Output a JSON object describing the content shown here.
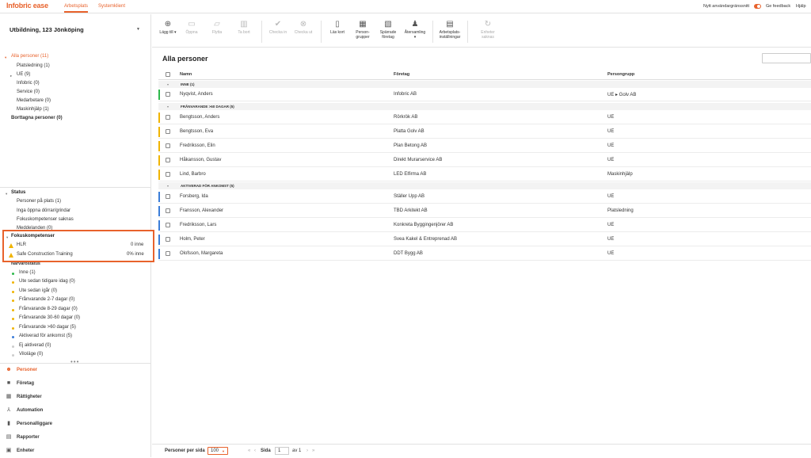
{
  "app": {
    "logo": "Infobric ease",
    "tabs": [
      "Arbetsplats",
      "Systemklient"
    ],
    "top_right": {
      "new_ui": "Nytt användargränssnitt",
      "feedback": "Ge feedback",
      "help": "Hjälp"
    },
    "accent_color": "#e8622c"
  },
  "sidebar": {
    "site_name": "Utbildning, 123 Jönköping",
    "groups": [
      {
        "label": "Alla personer (11)"
      },
      {
        "label": "Platsledning (1)"
      },
      {
        "label": "UE (9)"
      },
      {
        "label": "Infobric (0)"
      },
      {
        "label": "Service (0)"
      },
      {
        "label": "Medarbetare (0)"
      },
      {
        "label": "Maskinhjälp (1)"
      },
      {
        "label": "Borttagna personer (0)"
      }
    ],
    "status": {
      "heading": "Status",
      "items": [
        "Personer på plats (1)",
        "Inga öppna dörrar/grindar",
        "Fokuskompetenser saknas",
        "Meddelanden (0)"
      ]
    },
    "focus": {
      "heading": "Fokuskompetenser",
      "items": [
        {
          "label": "HLR",
          "value": "0 inne"
        },
        {
          "label": "Safe Construction Training",
          "value": "0% inne"
        }
      ]
    },
    "presence": {
      "heading": "Närvarostatus",
      "items": [
        {
          "label": "Inne (1)",
          "color": "#2eb84b"
        },
        {
          "label": "Ute sedan tidigare idag (0)",
          "color": "#f0b400"
        },
        {
          "label": "Ute sedan igår (0)",
          "color": "#f0b400"
        },
        {
          "label": "Frånvarande 2-7 dagar (0)",
          "color": "#f0b400"
        },
        {
          "label": "Frånvarande 8-29 dagar (0)",
          "color": "#f0b400"
        },
        {
          "label": "Frånvarande 30-60 dagar (0)",
          "color": "#f0b400"
        },
        {
          "label": "Frånvarande >60 dagar (5)",
          "color": "#f0b400"
        },
        {
          "label": "Aktiverad för ankomst (5)",
          "color": "#3b7dd8"
        },
        {
          "label": "Ej aktiverad (0)",
          "color": "#cccccc"
        },
        {
          "label": "Viloläge (0)",
          "color": "#cccccc"
        }
      ]
    },
    "nav": [
      {
        "label": "Personer",
        "icon": "people-icon"
      },
      {
        "label": "Företag",
        "icon": "briefcase-icon"
      },
      {
        "label": "Rättigheter",
        "icon": "calendar-icon"
      },
      {
        "label": "Automation",
        "icon": "network-icon"
      },
      {
        "label": "Personalliggare",
        "icon": "book-icon"
      },
      {
        "label": "Rapporter",
        "icon": "report-icon"
      },
      {
        "label": "Enheter",
        "icon": "device-icon"
      }
    ]
  },
  "toolbar": {
    "items": [
      {
        "label": "Lägg till",
        "icon": "plus-circle-icon",
        "disabled": false
      },
      {
        "label": "Öppna",
        "icon": "folder-open-icon",
        "disabled": true
      },
      {
        "label": "Flytta",
        "icon": "move-icon",
        "disabled": true
      },
      {
        "label": "Ta bort",
        "icon": "trash-icon",
        "disabled": true
      },
      {
        "label": "Checka in",
        "icon": "check-circle-icon",
        "disabled": true
      },
      {
        "label": "Checka ut",
        "icon": "x-circle-icon",
        "disabled": true
      },
      {
        "label": "Läs kort",
        "icon": "card-reader-icon",
        "disabled": false
      },
      {
        "label": "Person-\ngrupper",
        "icon": "group-icon",
        "disabled": false
      },
      {
        "label": "Spärrade\nföretag",
        "icon": "blocked-company-icon",
        "disabled": false
      },
      {
        "label": "Återsamling",
        "icon": "bell-icon",
        "disabled": false
      },
      {
        "label": "Arbetsplats-\ninställningar",
        "icon": "settings-icon",
        "disabled": false
      },
      {
        "label": "Enheter\nsaknas",
        "icon": "sync-icon",
        "disabled": true
      }
    ]
  },
  "main": {
    "title": "Alla personer",
    "columns": [
      "Namn",
      "Företag",
      "Persongrupp"
    ],
    "groups": [
      {
        "label": "INNE (1)",
        "color": "#2eb84b",
        "rows": [
          {
            "name": "Nyqvist, Anders",
            "company": "Infobric AB",
            "group": "UE ▸ Golv AB"
          }
        ]
      },
      {
        "label": "FRÅNVARANDE >60 DAGAR (5)",
        "color": "#f0b400",
        "rows": [
          {
            "name": "Bengtsson, Anders",
            "company": "Rörkrök AB",
            "group": "UE"
          },
          {
            "name": "Bengtsson, Eva",
            "company": "Platta Golv AB",
            "group": "UE"
          },
          {
            "name": "Fredriksson, Elin",
            "company": "Plan Betong AB",
            "group": "UE"
          },
          {
            "name": "Håkansson, Gustav",
            "company": "Direkt Murarservice AB",
            "group": "UE"
          },
          {
            "name": "Lind, Barbro",
            "company": "LED Elfirma AB",
            "group": "Maskinhjälp"
          }
        ]
      },
      {
        "label": "AKTIVERAD FÖR ANKOMST (5)",
        "color": "#3b7dd8",
        "rows": [
          {
            "name": "Forsberg, Ida",
            "company": "Ställer Upp AB",
            "group": "UE"
          },
          {
            "name": "Fransson, Alexander",
            "company": "TBD Arkitekt AB",
            "group": "Platsledning"
          },
          {
            "name": "Fredriksson, Lars",
            "company": "Konkreta Byggingenjörer AB",
            "group": "UE"
          },
          {
            "name": "Holm, Peter",
            "company": "Svea Kakel & Entreprenad AB",
            "group": "UE"
          },
          {
            "name": "Olofsson, Margareta",
            "company": "DDT Bygg AB",
            "group": "UE"
          }
        ]
      }
    ]
  },
  "footer": {
    "per_page_label": "Personer per sida",
    "per_page_value": "100",
    "page_label": "Sida",
    "page_value": "1",
    "of_label": "av 1"
  }
}
